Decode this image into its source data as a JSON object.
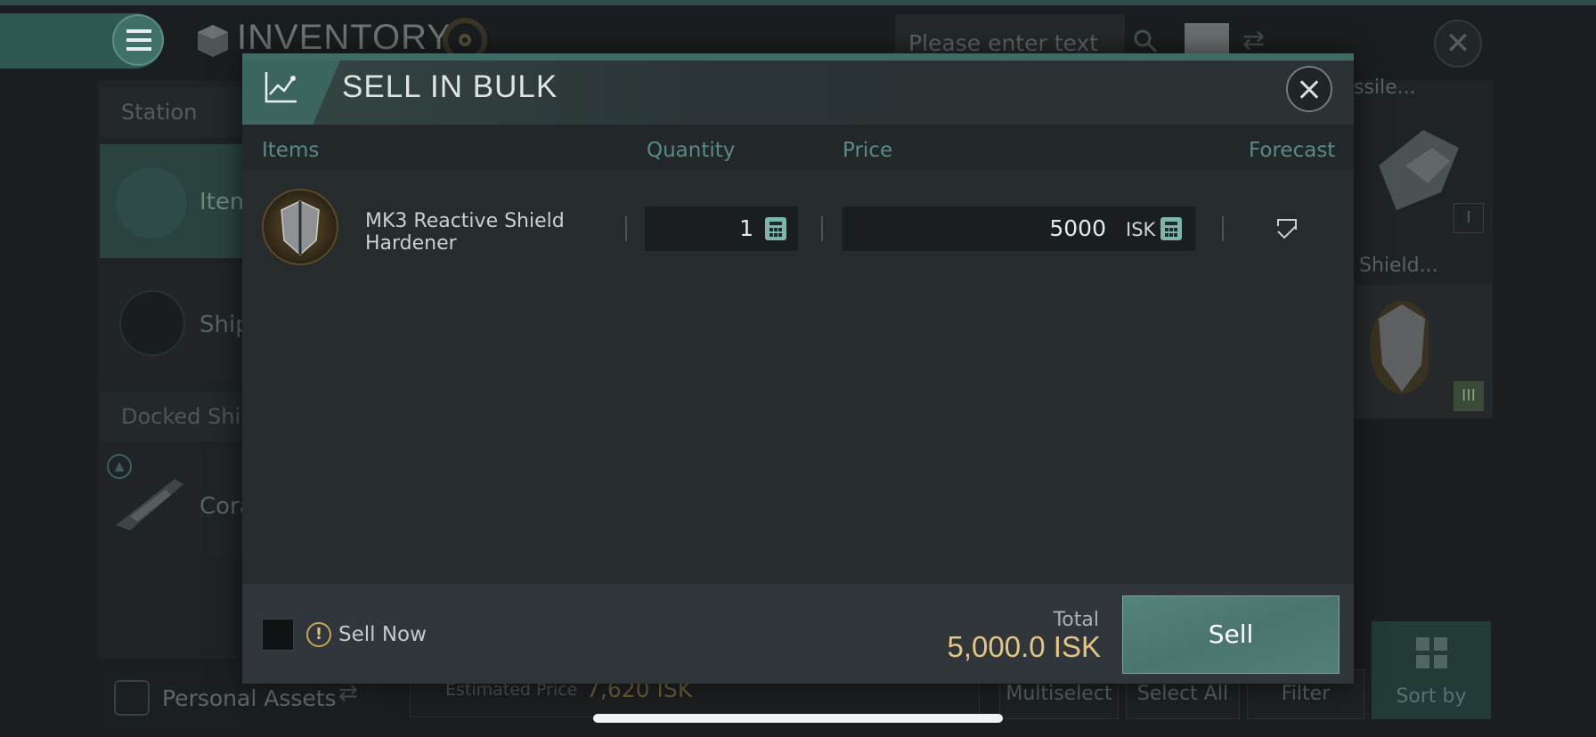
{
  "background": {
    "title": "INVENTORY",
    "search": {
      "placeholder": "Please enter text"
    },
    "sidebar": {
      "section_station": "Station",
      "items": [
        {
          "label": "Item"
        },
        {
          "label": "Ship"
        }
      ],
      "section_docked": "Docked Ship",
      "docked_item": "Cora"
    },
    "right_cards": [
      {
        "label": "ssile..."
      },
      {
        "label": "Shield...",
        "badge": "III"
      }
    ],
    "right_card_badge": "I",
    "bottom": {
      "personal_assets": "Personal Assets",
      "estimated_price_label": "Estimated Price",
      "estimated_price_value": "7,620 ISK",
      "multiselect": "Multiselect",
      "select_all": "Select All",
      "filter": "Filter",
      "sort_by": "Sort by"
    }
  },
  "modal": {
    "title": "SELL IN BULK",
    "columns": {
      "items": "Items",
      "quantity": "Quantity",
      "price": "Price",
      "forecast": "Forecast"
    },
    "rows": [
      {
        "name": "MK3 Reactive Shield Hardener",
        "quantity": "1",
        "price": "5000",
        "currency": "ISK"
      }
    ],
    "footer": {
      "sell_now_label": "Sell Now",
      "sell_now_checked": false,
      "total_label": "Total",
      "total_value": "5,000.0 ISK",
      "sell_button": "Sell"
    }
  },
  "colors": {
    "accent": "#4a756e",
    "total": "#e6c584",
    "warning": "#c9a35c"
  }
}
